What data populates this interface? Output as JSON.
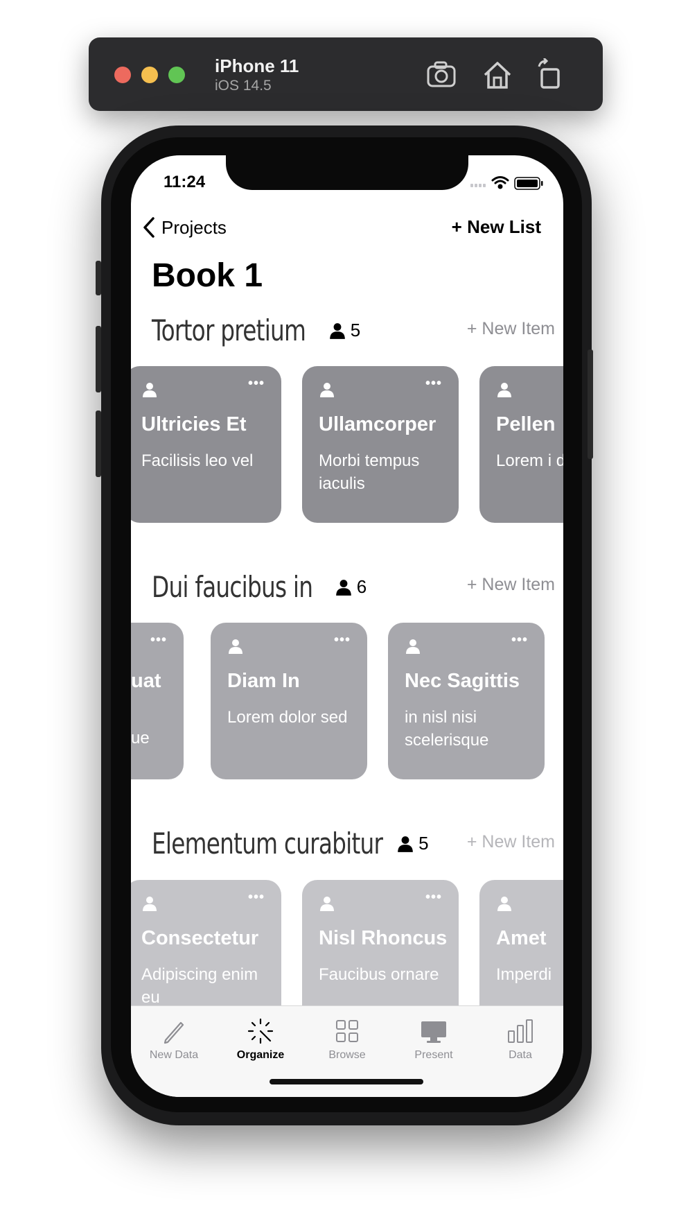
{
  "simulator": {
    "device": "iPhone 11",
    "os": "iOS 14.5",
    "icons": [
      "screenshot-icon",
      "home-icon",
      "rotate-icon"
    ]
  },
  "status_bar": {
    "time": "11:24"
  },
  "nav": {
    "back_label": "Projects",
    "new_list_label": "+ New List"
  },
  "page_title": "Book 1",
  "sections": [
    {
      "title": "Tortor pretium",
      "member_count": "5",
      "new_item_label": "+ New Item",
      "cards": [
        {
          "title": "Ultricies Et",
          "subtitle": "Facilisis leo vel"
        },
        {
          "title": "Ullamcorper",
          "subtitle": "Morbi tempus iaculis"
        },
        {
          "title": "Pellen",
          "subtitle": "Lorem i dolor"
        }
      ]
    },
    {
      "title": "Dui faucibus in",
      "member_count": "6",
      "new_item_label": "+ New Item",
      "cards": [
        {
          "title": "uat",
          "subtitle": "ue"
        },
        {
          "title": "Diam In",
          "subtitle": "Lorem dolor sed"
        },
        {
          "title": "Nec Sagittis",
          "subtitle": "in nisl nisi scelerisque"
        }
      ]
    },
    {
      "title": "Elementum curabitur",
      "member_count": "5",
      "new_item_label": "+ New Item",
      "cards": [
        {
          "title": "Consectetur",
          "subtitle": "Adipiscing enim eu"
        },
        {
          "title": "Nisl Rhoncus",
          "subtitle": "Faucibus ornare"
        },
        {
          "title": "Amet",
          "subtitle": "Imperdi"
        }
      ]
    }
  ],
  "tabs": [
    {
      "label": "New Data",
      "icon": "pencil-icon"
    },
    {
      "label": "Organize",
      "icon": "magic-wand-icon",
      "active": true
    },
    {
      "label": "Browse",
      "icon": "grid-icon"
    },
    {
      "label": "Present",
      "icon": "monitor-icon"
    },
    {
      "label": "Data",
      "icon": "bar-chart-icon"
    }
  ]
}
